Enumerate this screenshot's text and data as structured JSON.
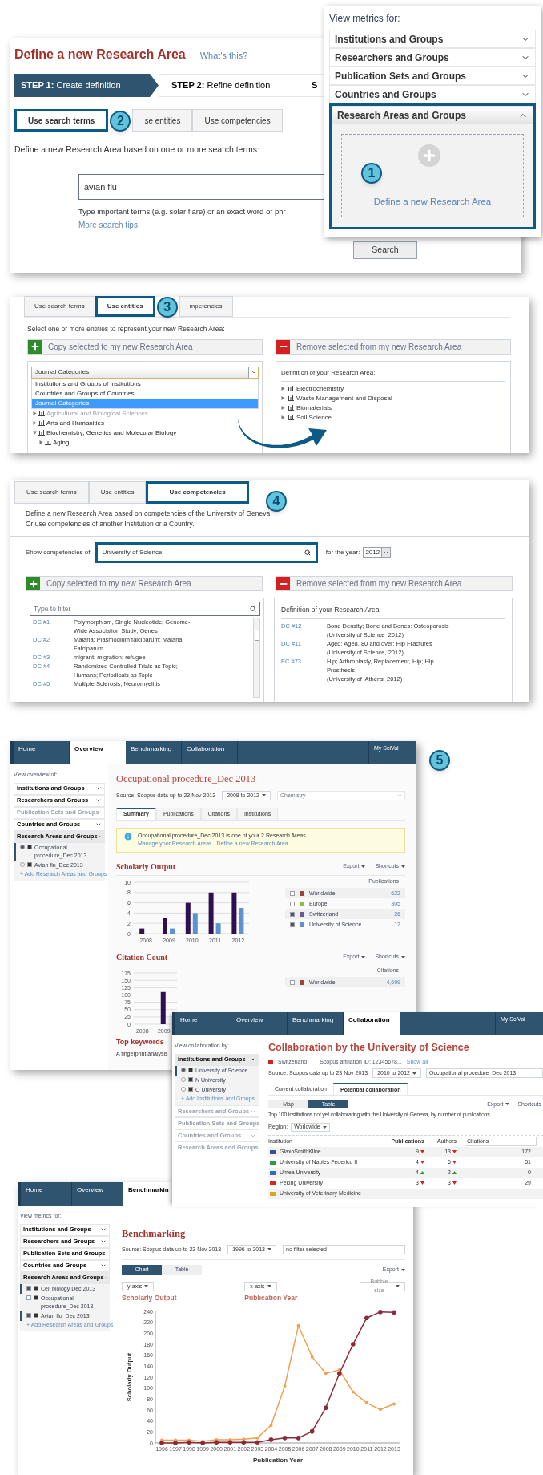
{
  "define_panel": {
    "title": "Define a new Research Area",
    "help_link": "What's this?",
    "steps": [
      {
        "prefix": "STEP 1:",
        "label": "Create definition",
        "selected": true
      },
      {
        "prefix": "STEP 2:",
        "label": "Refine definition",
        "selected": false
      },
      {
        "prefix": "S",
        "selected": false
      }
    ],
    "tabs": [
      {
        "label": "Use search terms",
        "selected": true
      },
      {
        "label": "se entities",
        "selected": false
      },
      {
        "label": "Use competencies",
        "selected": false
      }
    ],
    "callout_number": "2",
    "description": "Define a new Research Area based on one or more search terms:",
    "search_field": {
      "value": "avian flu"
    },
    "hint": "Type important terms (e.g. solar flare) or an exact word or phr",
    "tips_link": "More search tips",
    "search_button": "Search"
  },
  "metrics_menu": {
    "heading": "View metrics for:",
    "groups": [
      {
        "label": "Institutions and Groups",
        "expanded": false
      },
      {
        "label": "Researchers and Groups",
        "expanded": false
      },
      {
        "label": "Publication Sets and Groups",
        "expanded": false
      },
      {
        "label": "Countries and Groups",
        "expanded": false
      },
      {
        "label": "Research Areas and Groups",
        "expanded": true
      }
    ],
    "callout_number": "1",
    "define_link": "Define a new Research Area"
  },
  "entities_panel": {
    "tabs": [
      {
        "label": "Use search terms",
        "selected": false
      },
      {
        "label": "Use entities",
        "selected": true
      },
      {
        "label": "mpetencies",
        "selected": false
      }
    ],
    "callout_number": "3",
    "instruction": "Select one or more entities to represent your new Research Area:",
    "copy_button": "Copy selected to my new Research Area",
    "remove_button": "Remove selected from my new Research Area",
    "dropdown": {
      "value": "Journal Categories",
      "options": [
        {
          "label": "Institutions and Groups of Institutions",
          "selected": false
        },
        {
          "label": "Countries and Groups of Countries",
          "selected": false
        },
        {
          "label": "Journal Categories",
          "selected": true
        }
      ]
    },
    "tree": [
      {
        "label": "Agricultural and Biological Sciences",
        "disabled": true,
        "expanded": false
      },
      {
        "label": "Arts and Humanities",
        "disabled": false,
        "expanded": false
      },
      {
        "label": "Biochemistry, Genetics and Molecular Biology",
        "disabled": false,
        "expanded": true,
        "children": [
          {
            "label": "Aging",
            "disabled": false,
            "expanded": false
          }
        ]
      }
    ],
    "definition_heading": "Definition of your Research Area:",
    "definition": [
      {
        "label": "Electrochemistry"
      },
      {
        "label": "Waste Management and Disposal"
      },
      {
        "label": "Biomaterials"
      },
      {
        "label": "Soil Science"
      }
    ]
  },
  "competencies_panel": {
    "tabs": [
      {
        "label": "Use search terms",
        "selected": false
      },
      {
        "label": "Use entities",
        "selected": false
      },
      {
        "label": "Use competencies",
        "selected": true
      }
    ],
    "callout_number": "4",
    "description": [
      "Define a new Research Area based on competencies of the University of Geneva.",
      "Or use competencies of another Institution or a Country."
    ],
    "show_label": "Show competencies of:",
    "entity_field": {
      "value": "University of Science"
    },
    "year_label": "for the year:",
    "year_select": "2012",
    "copy_button": "Copy selected to my new Research Area",
    "remove_button": "Remove selected from my new Research Area",
    "filter": {
      "placeholder": "Type to filter"
    },
    "competencies": [
      {
        "code": "DC #1",
        "topics": "Polymorphism, Single Nucleotide; Genome-Wide Association Study; Genes"
      },
      {
        "code": "DC #2",
        "topics": "Malaria; Plasmodium falciparum; Malaria, Falciparum"
      },
      {
        "code": "DC #3",
        "topics": "migrant; migration; refugee"
      },
      {
        "code": "DC #4",
        "topics": "Randomized Controlled Trials as Topic; Humans; Periodicals as Topic"
      },
      {
        "code": "DC #5",
        "topics": "Multiple Sclerosis; Neuromyelitis"
      }
    ],
    "definition_heading": "Definition of your Research Area:",
    "definition": [
      {
        "code": "DC #12",
        "topics": "Bone Density; Bone and Bones: Osteoporosis",
        "source": "(University of Science  2012)"
      },
      {
        "code": "DC #11",
        "topics": "Aged; Aged, 80 and over; Hip Fractures",
        "source": "(University of Science, 2012)"
      },
      {
        "code": "EC #73",
        "topics": "Hip; Arthroplasty, Replacement, Hip; Hip Prosthesis",
        "source": "(University of  Athens, 2012)"
      }
    ]
  },
  "overview_page": {
    "nav": [
      {
        "label": "Home",
        "selected": false
      },
      {
        "label": "Overview",
        "selected": true
      },
      {
        "label": "Benchmarking",
        "selected": false
      },
      {
        "label": "Collaboration",
        "selected": false
      }
    ],
    "account": "My SciVal",
    "callout_number": "5",
    "sidebar": {
      "heading": "View overview of:",
      "kind": "radio",
      "groups": [
        {
          "label": "Institutions and Groups",
          "expanded": false,
          "disabled": false
        },
        {
          "label": "Researchers and Groups",
          "expanded": false,
          "disabled": false
        },
        {
          "label": "Publication Sets and Groups",
          "expanded": false,
          "disabled": true
        },
        {
          "label": "Countries and Groups",
          "expanded": false,
          "disabled": false
        },
        {
          "label": "Research Areas and Groups",
          "expanded": true,
          "disabled": false,
          "items": [
            {
              "label": "Occupational procedure_Dec 2013",
              "selected": true
            },
            {
              "label": "Avian flu_Dec 2013",
              "selected": false
            }
          ],
          "add_link": "+ Add Research Areas and Groups"
        }
      ]
    },
    "title": "Occupational procedure_Dec 2013",
    "source": "Source: Scopus data up to 23 Nov 2013",
    "range": "2008 to 2012",
    "subject_filter": {
      "placeholder": "Chemistry"
    },
    "tabs": [
      {
        "label": "Summary",
        "selected": true
      },
      {
        "label": "Publications",
        "selected": false
      },
      {
        "label": "Citations",
        "selected": false
      },
      {
        "label": "Institutions",
        "selected": false
      }
    ],
    "info": {
      "text": "Occupational procedure_Dec 2013 is one of your 2 Research Areas",
      "links": [
        "Manage your Research Areas",
        "Define a new Research Area"
      ]
    },
    "scholarly_output": {
      "title": "Scholarly Output",
      "export": "Export",
      "shortcuts": "Shortcuts",
      "legend_heading": "Publications",
      "legend": [
        {
          "label": "Worldwide",
          "color": "#a0413a",
          "checked": false,
          "count": "622"
        },
        {
          "label": "Europe",
          "color": "#8fbf3a",
          "checked": false,
          "count": "305"
        },
        {
          "label": "Switzerland",
          "color": "#6a5a9a",
          "checked": true,
          "count": "26"
        },
        {
          "label": "University of Science",
          "color": "#5b93cf",
          "checked": true,
          "count": "12"
        }
      ],
      "chart_data": {
        "type": "bar",
        "grid": true,
        "categories": [
          "2008",
          "2009",
          "2010",
          "2011",
          "2012"
        ],
        "yticks": [
          0,
          2,
          4,
          6,
          8,
          10
        ],
        "ylim": [
          0,
          10
        ],
        "series": [
          {
            "color": "#2e0f4f",
            "values": [
              1,
              3,
              6,
              8,
              8
            ]
          },
          {
            "color": "#5b93cf",
            "values": [
              null,
              1,
              4,
              2,
              5
            ]
          }
        ]
      }
    },
    "citation_count": {
      "title": "Citation Count",
      "export": "Export",
      "shortcuts": "Shortcuts",
      "legend_heading": "Citations",
      "legend": [
        {
          "label": "Worldwide",
          "color": "#a0413a",
          "checked": false,
          "count": "4,699"
        }
      ],
      "chart_data": {
        "type": "bar",
        "grid": true,
        "categories": [
          "2008",
          "2009"
        ],
        "yticks": [
          0,
          25,
          50,
          75,
          100,
          125,
          150,
          175
        ],
        "ylim": [
          0,
          175
        ],
        "series": [
          {
            "color": "#2e0f4f",
            "values": [
              null,
              110
            ]
          }
        ]
      }
    },
    "keywords_title": "Top keywords",
    "keywords_text": "A fingerprint analysis"
  },
  "collaboration_page": {
    "nav": [
      {
        "label": "Home",
        "selected": false
      },
      {
        "label": "Overview",
        "selected": false
      },
      {
        "label": "Benchmarking",
        "selected": false
      },
      {
        "label": "Collaboration",
        "selected": true
      }
    ],
    "account": "My SciVal",
    "sidebar": {
      "heading": "View collaboration by:",
      "kind": "radio",
      "groups": [
        {
          "label": "Institutions and Groups",
          "expanded": true,
          "disabled": false,
          "items": [
            {
              "label": "University of Science",
              "selected": true
            },
            {
              "label": "N University",
              "selected": false
            },
            {
              "label": "O University",
              "selected": false
            }
          ],
          "add_link": "+ Add Institutions and Groups"
        },
        {
          "label": "Researchers and Groups",
          "expanded": false,
          "disabled": true
        },
        {
          "label": "Publication Sets and Groups",
          "expanded": false,
          "disabled": true
        },
        {
          "label": "Countries and Groups",
          "expanded": false,
          "disabled": true
        },
        {
          "label": "Research Areas and Groups",
          "expanded": false,
          "disabled": true
        }
      ]
    },
    "title": "Collaboration by the University of Science",
    "country": "Switzerland",
    "affiliation": "Scopus affiliation ID: 12345678...",
    "show_all": "Show all",
    "source": "Source: Scopus data up to 23 Nov 2013",
    "range": "2010 to 2012",
    "research_area": "Occupational procedure_Dec 2013",
    "tabs": [
      {
        "label": "Current collaboration",
        "selected": false
      },
      {
        "label": "Potential collaboration",
        "selected": true
      }
    ],
    "views": [
      {
        "label": "Map",
        "selected": false
      },
      {
        "label": "Table",
        "selected": true
      }
    ],
    "export": "Export",
    "shortcuts": "Shortcuts",
    "description": "Top 100 institutions not yet collaborating with the University of Geneva, by number of publications",
    "region_label": "Region:",
    "region": "Worldwide",
    "table": {
      "columns": [
        "Institution",
        "Publications",
        "Authors",
        "Citations"
      ],
      "rows": [
        {
          "institution": "GlaxoSmithKline",
          "color": "#3b4c9b",
          "publications": "9",
          "authors": "13",
          "citations": "172",
          "rising": false
        },
        {
          "institution": "University of Naples Federico II",
          "color": "#2e9b45",
          "publications": "4",
          "authors": "6",
          "citations": "51",
          "rising": false
        },
        {
          "institution": "Umea University",
          "color": "#2f6db5",
          "publications": "4",
          "authors": "2",
          "citations": "0",
          "rising": true
        },
        {
          "institution": "Peking University",
          "color": "#d82a20",
          "publications": "3",
          "authors": "3",
          "citations": "29",
          "rising": false
        },
        {
          "institution": "University of Veterinary Medicine",
          "color": "#e0a020"
        }
      ]
    }
  },
  "benchmarking_page": {
    "nav": [
      {
        "label": "Home",
        "selected": false
      },
      {
        "label": "Overview",
        "selected": false
      },
      {
        "label": "Benchmarkin",
        "selected": true
      }
    ],
    "sidebar": {
      "heading": "View metrics for:",
      "kind": "checkbox",
      "groups": [
        {
          "label": "Institutions and Groups",
          "expanded": false,
          "disabled": false
        },
        {
          "label": "Researchers and Groups",
          "expanded": false,
          "disabled": false
        },
        {
          "label": "Publication Sets and Groups",
          "expanded": false,
          "disabled": false
        },
        {
          "label": "Countries and Groups",
          "expanded": false,
          "disabled": false
        },
        {
          "label": "Research Areas and Groups",
          "expanded": true,
          "disabled": false,
          "items": [
            {
              "label": "Cell biology Dec 2013",
              "checked": true
            },
            {
              "label": "Occupational procedure_Dec 2013",
              "checked": false
            },
            {
              "label": "Avian flu_Dec 2013",
              "checked": true
            }
          ],
          "add_link": "+ Add Research Areas and Groups"
        }
      ]
    },
    "title": "Benchmarking",
    "source": "Source: Scopus data up to 23 Nov 2013",
    "range": "1996 to 2013",
    "filter": "no filter selected",
    "views": [
      {
        "label": "Chart",
        "selected": true
      },
      {
        "label": "Table",
        "selected": false
      }
    ],
    "export": "Export",
    "y_axis": "y-axis",
    "x_axis": "x-axis",
    "bubble_size": {
      "label": "Bubble size",
      "disabled": true
    },
    "y_title": "Scholarly Output",
    "x_title": "Publication Year",
    "chart_data": {
      "type": "line",
      "x": [
        "1996",
        "1997",
        "1998",
        "1999",
        "2000",
        "2001",
        "2002",
        "2003",
        "2004",
        "2005",
        "2006",
        "2007",
        "2008",
        "2009",
        "2010",
        "2011",
        "2012",
        "2013"
      ],
      "xlabel": "Publication Year",
      "ylabel": "Scholarly Output",
      "yticks": [
        0,
        20,
        40,
        60,
        80,
        100,
        120,
        140,
        160,
        180,
        200,
        220,
        240
      ],
      "ylim": [
        0,
        240
      ],
      "series": [
        {
          "color": "#f0a050",
          "values": [
            5,
            5,
            5,
            3,
            6,
            6,
            7,
            9,
            32,
            104,
            214,
            157,
            127,
            133,
            93,
            73,
            61,
            71
          ]
        },
        {
          "color": "#8a2a3a",
          "values": [
            0,
            0,
            1,
            0,
            1,
            1,
            1,
            1,
            6,
            9,
            9,
            21,
            64,
            127,
            180,
            228,
            239,
            238
          ]
        }
      ]
    }
  }
}
